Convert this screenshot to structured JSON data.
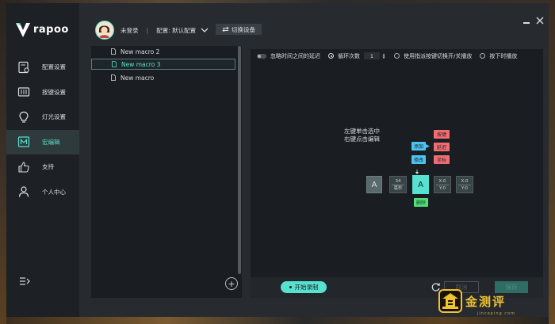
{
  "app": {
    "brand": "rapoo",
    "accent": "#56e2cf"
  },
  "header": {
    "user_label": "未登录",
    "separator": "|",
    "profile_label": "配置: 默认配置",
    "switch_device_label": "切换设备"
  },
  "sidebar": {
    "items": [
      {
        "label": "配置设置",
        "icon": "settings-page-icon"
      },
      {
        "label": "按键设置",
        "icon": "keys-icon"
      },
      {
        "label": "灯光设置",
        "icon": "bulb-icon"
      },
      {
        "label": "宏编辑",
        "icon": "macro-icon",
        "active": true
      },
      {
        "label": "支持",
        "icon": "thumbs-up-icon"
      },
      {
        "label": "个人中心",
        "icon": "user-icon"
      }
    ]
  },
  "macro_list": {
    "items": [
      {
        "label": "New macro 2"
      },
      {
        "label": "New macro 3",
        "selected": true
      },
      {
        "label": "New macro"
      }
    ],
    "add_label": "+"
  },
  "editor": {
    "options": {
      "ignore_delay": "忽略时间之间的延迟",
      "loop_count_label": "循环次数",
      "loop_count_value": "1",
      "toggle_switch": "使用指派按键切换开/关播放",
      "press_play": "按下时播放"
    },
    "hint_line1": "左键单击选中",
    "hint_line2": "右键点击编辑",
    "menu": {
      "add": "添加",
      "modify": "修改",
      "key": "按键",
      "delay": "延迟",
      "coordinate": "坐标",
      "delete": "删除"
    },
    "timeline": {
      "key1": "A",
      "delay_value": "34",
      "delay_unit": "毫秒",
      "key2": "A",
      "coord1_x": "X:0",
      "coord1_y": "Y:0",
      "coord2_x": "X:0",
      "coord2_y": "Y:0"
    }
  },
  "footer": {
    "record_label": "开始录制",
    "cancel_label": "取消",
    "save_label": "保存"
  },
  "watermark": {
    "text": "金测评",
    "sub": "jinceping.com"
  }
}
